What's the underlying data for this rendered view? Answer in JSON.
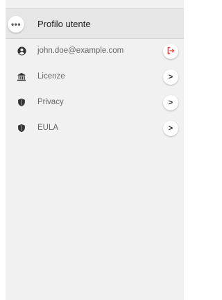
{
  "header": {
    "menu_glyph": "•••",
    "title": "Profilo utente"
  },
  "rows": [
    {
      "label": "john.doe@example.com",
      "icon": "user-circle-icon",
      "action": "logout-icon",
      "action_glyph": "[→"
    },
    {
      "label": "Licenze",
      "icon": "bank-icon",
      "action": "chevron-right-icon",
      "action_glyph": ">"
    },
    {
      "label": "Privacy",
      "icon": "shield-icon",
      "action": "chevron-right-icon",
      "action_glyph": ">"
    },
    {
      "label": "EULA",
      "icon": "shield-icon",
      "action": "chevron-right-icon",
      "action_glyph": ">"
    }
  ],
  "colors": {
    "panel_bg": "#f1f1f1",
    "header_bg": "#e6e6e6",
    "logout_accent": "#e53935",
    "icon": "#333333"
  }
}
